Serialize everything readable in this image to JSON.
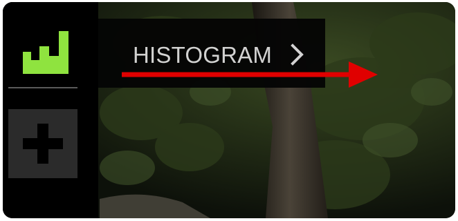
{
  "sidebar": {
    "items": [
      {
        "name": "histogram",
        "icon": "histogram-icon",
        "accent": "#8fe33f",
        "selected": true
      },
      {
        "name": "add",
        "icon": "plus-icon"
      }
    ]
  },
  "tooltip": {
    "label": "HISTOGRAM",
    "chevron_icon": "chevron-right-icon"
  },
  "annotation": {
    "arrow_color": "#e00000",
    "arrow_icon": "arrow-right-icon"
  }
}
